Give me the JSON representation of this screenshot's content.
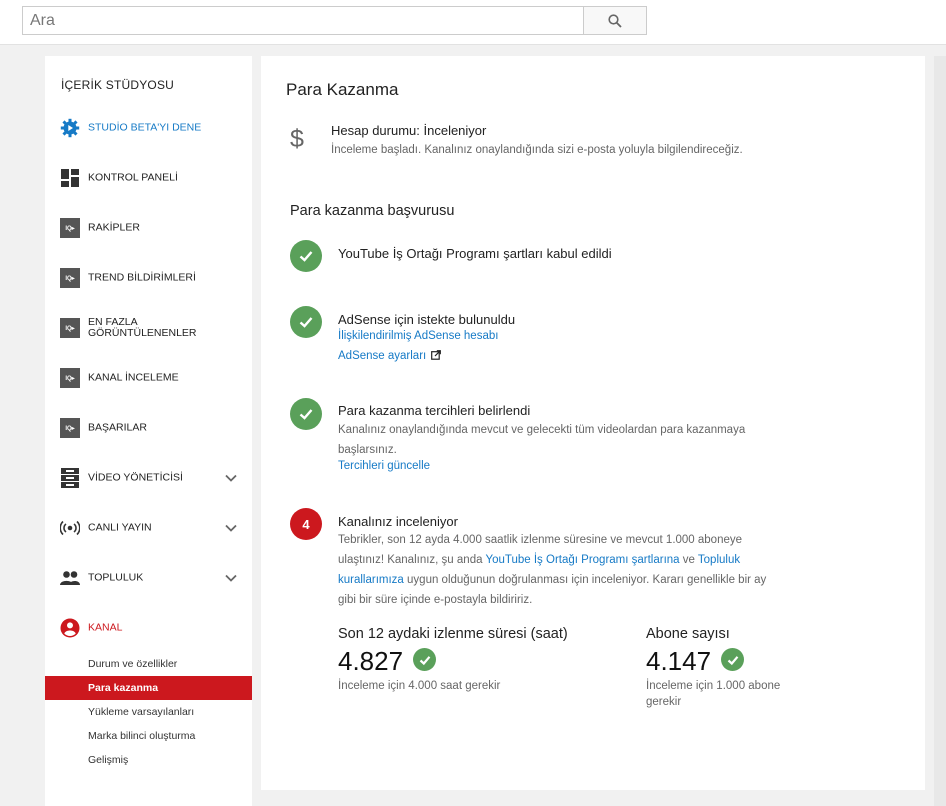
{
  "search": {
    "placeholder": "Ara"
  },
  "sidebar": {
    "title": "İÇERİK STÜDYOSU",
    "beta": "STUDİO BETA'YI DENE",
    "items": [
      {
        "label": "KONTROL PANELİ"
      },
      {
        "label": "RAKİPLER"
      },
      {
        "label": "TREND BİLDİRİMLERİ"
      },
      {
        "label": "EN FAZLA",
        "label2": "GÖRÜNTÜLENENLER"
      },
      {
        "label": "KANAL İNCELEME"
      },
      {
        "label": "BAŞARILAR"
      },
      {
        "label": "VİDEO YÖNETİCİSİ"
      },
      {
        "label": "CANLI YAYIN"
      },
      {
        "label": "TOPLULUK"
      },
      {
        "label": "KANAL"
      }
    ],
    "channel_sub": [
      {
        "label": "Durum ve özellikler"
      },
      {
        "label": "Para kazanma"
      },
      {
        "label": "Yükleme varsayılanları"
      },
      {
        "label": "Marka bilinci oluşturma"
      },
      {
        "label": "Gelişmiş"
      }
    ]
  },
  "colors": {
    "accent": "#cc181e",
    "success": "#5aa05a",
    "link": "#167ac6"
  },
  "main": {
    "title": "Para Kazanma",
    "status": {
      "title": "Hesap durumu: İnceleniyor",
      "desc": "İnceleme başladı. Kanalınız onaylandığında sizi e-posta yoluyla bilgilendireceğiz."
    },
    "section_title": "Para kazanma başvurusu",
    "steps": [
      {
        "title": "YouTube İş Ortağı Programı şartları kabul edildi"
      },
      {
        "title": "AdSense için istekte bulunuldu",
        "link1": "İlişkilendirilmiş AdSense hesabı",
        "link2": "AdSense ayarları"
      },
      {
        "title": "Para kazanma tercihleri belirlendi",
        "desc": "Kanalınız onaylandığında mevcut ve gelecekti tüm videolardan para kazanmaya başlarsınız.",
        "link": "Tercihleri güncelle"
      },
      {
        "number": "4",
        "title": "Kanalınız inceleniyor",
        "desc_a": "Tebrikler, son 12 ayda 4.000 saatlik izlenme süresine ve mevcut 1.000 aboneye ulaştınız! Kanalınız, şu anda ",
        "link_a": "YouTube İş Ortağı Programı şartlarına",
        "desc_b": " ve ",
        "link_b": "Topluluk kurallarımıza",
        "desc_c": " uygun olduğunun doğrulanması için inceleniyor. Kararı genellikle bir ay gibi bir süre içinde e-postayla bildiririz."
      }
    ],
    "stats": [
      {
        "label": "Son 12 aydaki izlenme süresi (saat)",
        "value": "4.827",
        "note": "İnceleme için 4.000 saat gerekir"
      },
      {
        "label": "Abone sayısı",
        "value": "4.147",
        "note": "İnceleme için 1.000 abone gerekir"
      }
    ]
  }
}
